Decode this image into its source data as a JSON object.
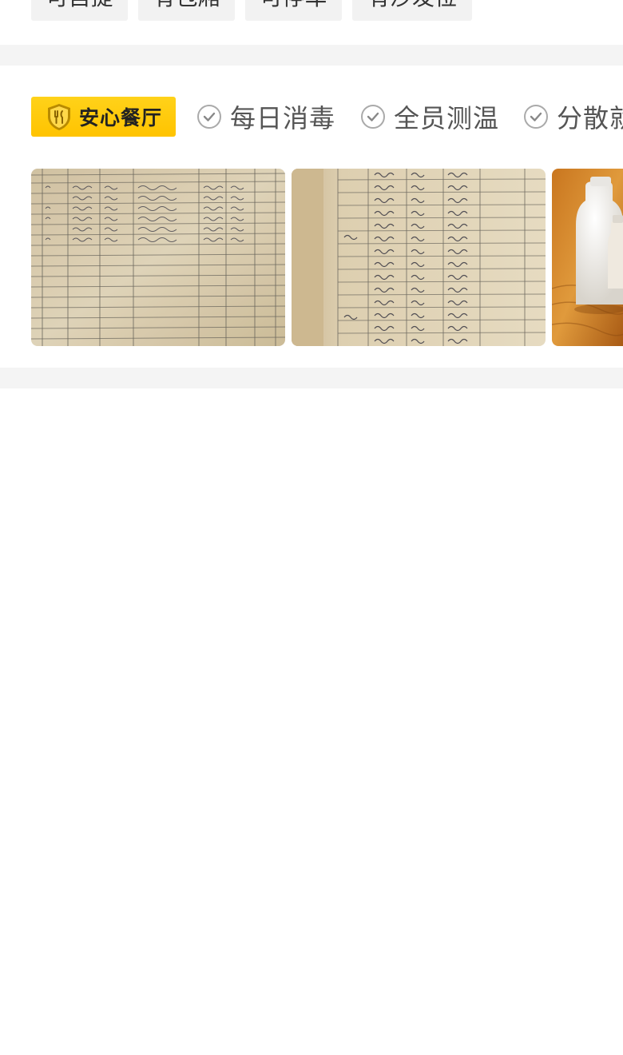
{
  "tags": [
    {
      "label": "可自提"
    },
    {
      "label": "有包厢"
    },
    {
      "label": "可停车"
    },
    {
      "label": "有沙发位"
    }
  ],
  "safety": {
    "badge_label": "安心餐厅",
    "features": [
      {
        "label": "每日消毒",
        "icon": "check-circle-icon"
      },
      {
        "label": "全员测温",
        "icon": "check-circle-icon"
      },
      {
        "label": "分散就"
      }
    ],
    "photos": [
      {
        "name": "disinfection-log-photo"
      },
      {
        "name": "temperature-log-photo"
      },
      {
        "name": "sanitizer-bottles-photo"
      }
    ]
  },
  "colors": {
    "badge": "#ffc300",
    "divider": "#f4f4f4",
    "tag_bg": "#f2f2f2",
    "feature_text": "#555555"
  }
}
